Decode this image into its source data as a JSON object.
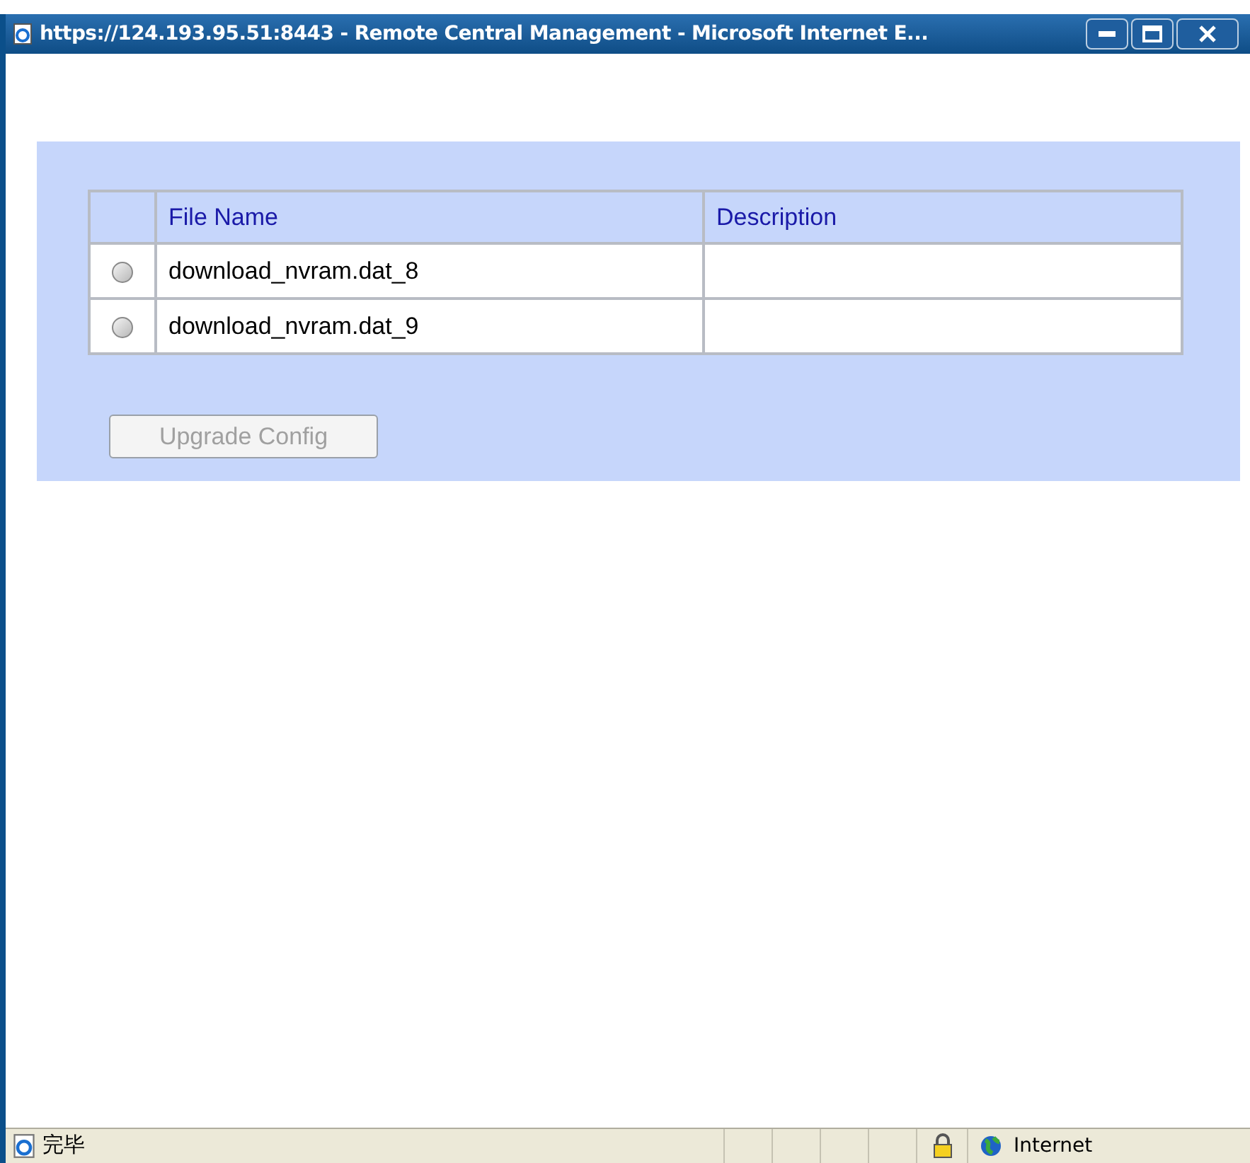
{
  "window": {
    "title": "https://124.193.95.51:8443 - Remote Central Management - Microsoft Internet E..."
  },
  "table": {
    "columns": [
      "File Name",
      "Description"
    ],
    "rows": [
      {
        "file_name": "download_nvram.dat_8",
        "description": "",
        "selected": false
      },
      {
        "file_name": "download_nvram.dat_9",
        "description": "",
        "selected": false
      }
    ]
  },
  "upgrade_button": {
    "label": "Upgrade Config",
    "disabled": true
  },
  "status_bar": {
    "text": "完毕",
    "zone": "Internet"
  }
}
